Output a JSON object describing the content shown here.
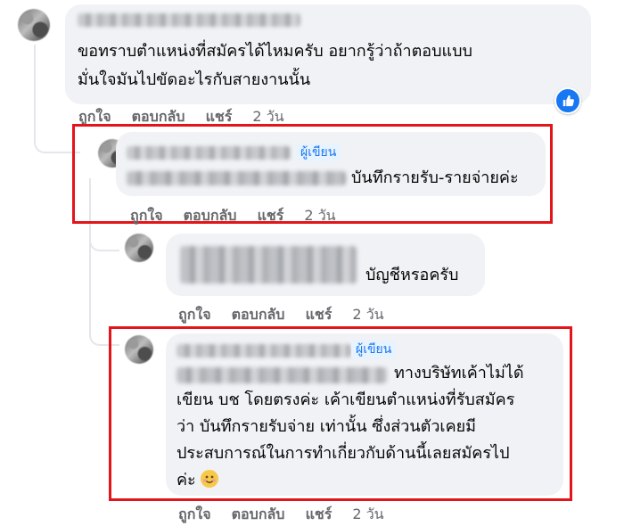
{
  "comments": [
    {
      "text_lines": [
        "ขอทราบตำแหน่งที่สมัครได้ไหมครับ อยากรู้ว่าถ้าตอบแบบ",
        "มั่นใจมันไปขัดอะไรกับสายงานนั้น"
      ],
      "actions": {
        "like": "ถูกใจ",
        "reply": "ตอบกลับ",
        "share": "แชร์",
        "time": "2 วัน"
      }
    },
    {
      "author_badge": "ผู้เขียน",
      "text": "บันทึกรายรับ-รายจ่ายค่ะ",
      "actions": {
        "like": "ถูกใจ",
        "reply": "ตอบกลับ",
        "share": "แชร์",
        "time": "2 วัน"
      }
    },
    {
      "text": "บัญชีหรอครับ",
      "actions": {
        "like": "ถูกใจ",
        "reply": "ตอบกลับ",
        "share": "แชร์",
        "time": "2 วัน"
      }
    },
    {
      "author_badge": "ผู้เขียน",
      "text_first": "ทางบริษัทเค้าไม่ได้",
      "text_lines": [
        "เขียน บช โดยตรงค่ะ เค้าเขียนตำแหน่งที่รับสมัคร",
        "ว่า บันทึกรายรับจ่าย เท่านั้น ซึ่งส่วนตัวเคยมี",
        "ประสบการณ์ในการทำเกี่ยวกับด้านนี้เลยสมัครไป",
        "ค่ะ"
      ],
      "actions": {
        "like": "ถูกใจ",
        "reply": "ตอบกลับ",
        "share": "แชร์",
        "time": "2 วัน"
      }
    }
  ],
  "colors": {
    "highlight": "#e4141b",
    "accent": "#1877f2",
    "bubble": "#f0f2f5"
  },
  "icons": {
    "reaction": "thumbs-up-icon",
    "emoji": "smiling-face-emoji"
  }
}
